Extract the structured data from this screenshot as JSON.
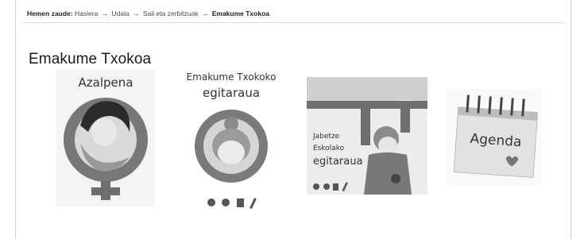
{
  "breadcrumb": {
    "lead": "Hemen zaude:",
    "items": [
      "Hasiera",
      "Udala",
      "Sail eta zerbitzuak"
    ],
    "current": "Emakume Txokoa",
    "separator": "→"
  },
  "page": {
    "title": "Emakume Txokoa"
  },
  "tiles": [
    {
      "label": "Azalpena"
    },
    {
      "label_line1": "Emakume Txokoko",
      "label_line2": "egitaraua"
    },
    {
      "label_line1": "Jabetze",
      "label_line2": "Eskolako",
      "label_line3": "egitaraua"
    },
    {
      "label": "Agenda"
    }
  ]
}
